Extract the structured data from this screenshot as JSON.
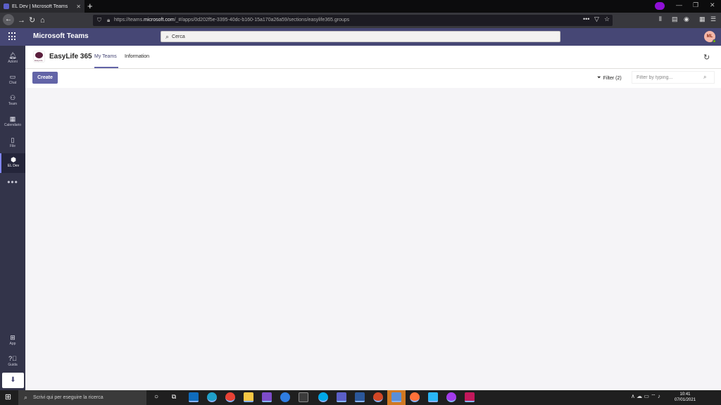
{
  "browser": {
    "tab_title": "EL Dev | Microsoft Teams",
    "url_prefix": "https://teams.",
    "url_domain": "microsoft.com",
    "url_suffix": "/_#/apps/0d202f5e-3395-40dc-b160-15a170a26a59/sections/easylife365.groups"
  },
  "teams": {
    "app_name": "Microsoft Teams",
    "search_placeholder": "Cerca",
    "avatar_initials": "ML"
  },
  "rail": {
    "items": [
      {
        "label": "Azioni",
        "icon": "bell-icon"
      },
      {
        "label": "Chat",
        "icon": "chat-icon"
      },
      {
        "label": "Team",
        "icon": "team-icon"
      },
      {
        "label": "Calendario",
        "icon": "calendar-icon"
      },
      {
        "label": "File",
        "icon": "file-icon"
      },
      {
        "label": "EL Dev",
        "icon": "eldev-icon"
      }
    ],
    "more": "•••",
    "bottom": [
      {
        "label": "App",
        "icon": "apps-icon"
      },
      {
        "label": "Guida",
        "icon": "help-icon"
      }
    ]
  },
  "app": {
    "logo_text": "EasyLife",
    "title": "EasyLife 365",
    "tabs": [
      "My Teams",
      "Information"
    ],
    "active_tab": "My Teams"
  },
  "toolbar": {
    "create_label": "Create",
    "filter_label": "Filter (2)",
    "filter_placeholder": "Filter by typing..."
  },
  "taskbar": {
    "search_placeholder": "Scrivi qui per eseguire la ricerca",
    "time": "10:41",
    "date": "07/01/2021"
  },
  "colors": {
    "teams_purple": "#464775",
    "accent": "#6264a7",
    "rail_bg": "#33344a"
  }
}
